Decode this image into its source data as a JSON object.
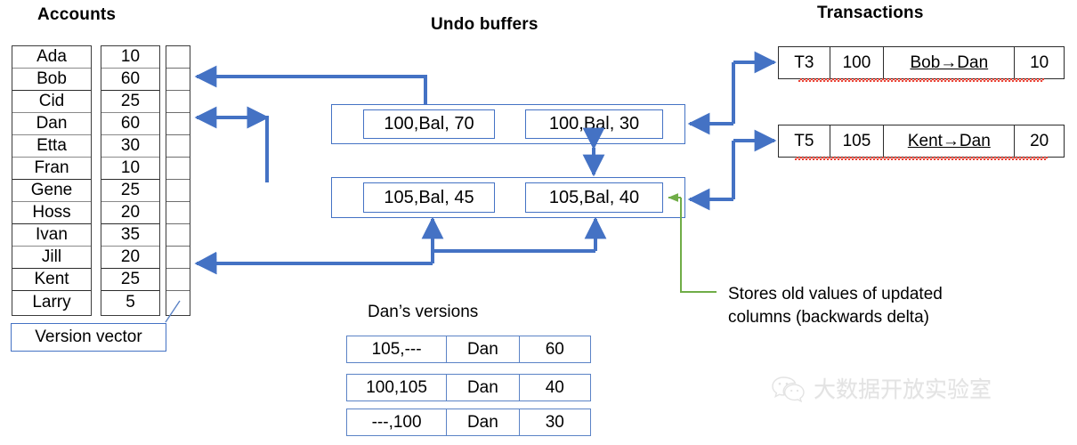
{
  "headings": {
    "accounts": "Accounts",
    "undo_buffers": "Undo buffers",
    "transactions": "Transactions"
  },
  "accounts": {
    "names": [
      "Ada",
      "Bob",
      "Cid",
      "Dan",
      "Etta",
      "Fran",
      "Gene",
      "Hoss",
      "Ivan",
      "Jill",
      "Kent",
      "Larry"
    ],
    "balances": [
      "10",
      "60",
      "25",
      "60",
      "30",
      "10",
      "25",
      "20",
      "35",
      "20",
      "25",
      "5"
    ],
    "version_vector_label": "Version vector",
    "version_vector_slots": 12
  },
  "undo_buffers": {
    "rows": [
      {
        "left": "100,Bal, 70",
        "right": "100,Bal, 30"
      },
      {
        "left": "105,Bal, 45",
        "right": "105,Bal, 40"
      }
    ]
  },
  "transactions": {
    "rows": [
      {
        "txid": "T3",
        "timestamp": "100",
        "operation": "Bob→Dan",
        "amount": "10"
      },
      {
        "txid": "T5",
        "timestamp": "105",
        "operation": "Kent→Dan",
        "amount": "20"
      }
    ]
  },
  "dans_versions": {
    "title": "Dan’s versions",
    "rows": [
      {
        "versions": "105,---",
        "name": "Dan",
        "value": "60"
      },
      {
        "versions": "100,105",
        "name": "Dan",
        "value": "40"
      },
      {
        "versions": "---,100",
        "name": "Dan",
        "value": "30"
      }
    ]
  },
  "annotation": {
    "text": "Stores old values of updated\ncolumns (backwards delta)"
  },
  "watermark": {
    "text": "大数据开放实验室"
  },
  "colors": {
    "arrow_blue": "#4472c4",
    "annotation_green": "#70ad47",
    "box_border_blue": "#4472c4",
    "table_border_black": "#2b2b2b",
    "spellcheck_red": "#e8392c",
    "watermark_gray": "#e3e3e3"
  }
}
